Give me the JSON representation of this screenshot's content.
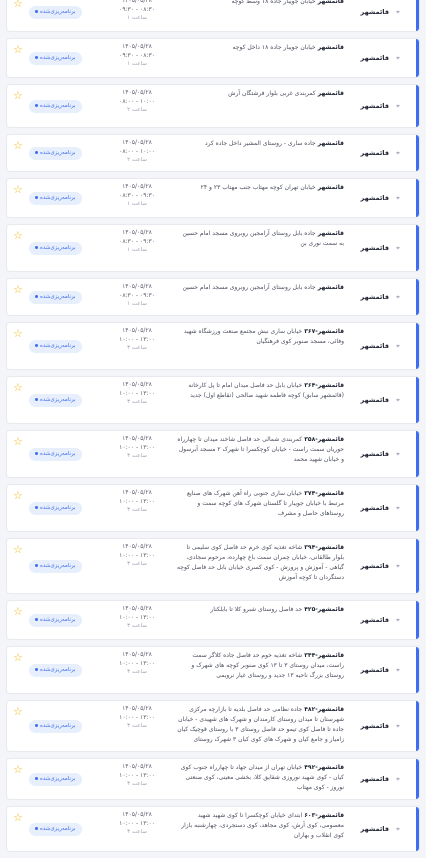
{
  "status_label": "برنامه‌ریزی‌شده",
  "colors": {
    "accent": "#3d6df2",
    "star": "#f2b70f",
    "badge_bg": "#e7eefc"
  },
  "icons": {
    "favorite": "star-icon",
    "location": "location-pin-icon"
  },
  "rows": [
    {
      "city": "قائمشهر",
      "desc": "خیابان جویبار جاده ۱۸ وسط کوچه",
      "date": "۱۴۰۵/۰۵/۲۸",
      "time": "۰۹:۳۰ - ۰۸:۳۰",
      "dur": "۱ ساعت"
    },
    {
      "city": "قائمشهر",
      "desc": "خیابان جویبار جاده ۱۸ داخل کوچه",
      "date": "۱۴۰۵/۰۵/۲۸",
      "time": "۰۹:۳۰ - ۰۸:۳۰",
      "dur": "۱ ساعت"
    },
    {
      "city": "قائمشهر",
      "desc": "کمربندی غربی بلوار فرشتگان آرش",
      "date": "۱۴۰۵/۰۵/۲۸",
      "time": "۰۸:۰۰ - ۱۰:۰۰",
      "dur": "۲ ساعت"
    },
    {
      "city": "قائمشهر",
      "desc": "جاده ساری - روستای المشیر داخل جاده کرد",
      "date": "۱۴۰۵/۰۵/۲۸",
      "time": "۰۸:۰۰ - ۱۰:۰۰",
      "dur": "۲ ساعت"
    },
    {
      "city": "قائمشهر",
      "desc": "خیابان تهران کوچه مهتاب جنب مهتاب ۲۳ و ۲۴",
      "date": "۱۴۰۵/۰۵/۲۸",
      "time": "۰۸:۳۰ - ۰۹:۳۰",
      "dur": "۱ ساعت"
    },
    {
      "city": "قائمشهر",
      "desc": "جاده بابل روستای آرامجین روبروی مسجد امام حسین به سمت نوری بن",
      "date": "۱۴۰۵/۰۵/۲۸",
      "time": "۰۸:۳۰ - ۰۹:۳۰",
      "dur": "۱ ساعت"
    },
    {
      "city": "قائمشهر",
      "desc": "جاده بابل روستای آرامجین روبروی مسجد امام حسین",
      "date": "۱۴۰۵/۰۵/۲۸",
      "time": "۰۸:۳۰ - ۰۹:۳۰",
      "dur": "۱ ساعت"
    },
    {
      "city": "قائمشهر",
      "prefix": "۳۶۷",
      "desc": "خیابان ساری نبش مجتمع صنعت ورزشگاه شهید وفائی، مسجد صنوبر کوی فرهنگیان",
      "date": "۱۴۰۵/۰۵/۲۸",
      "time": "۱۰:۰۰ - ۱۳:۰۰",
      "dur": "۳ ساعت"
    },
    {
      "city": "قائمشهر",
      "prefix": "۳۶۴",
      "desc": "خیابان بابل حد فاصل میدان امام تا پل کارخانه (قائمشهر سابق) کوچه فاطمه شهید صالحی (تقاطع اول) جدید",
      "date": "۱۴۰۵/۰۵/۲۸",
      "time": "۱۰:۰۰ - ۱۳:۰۰",
      "dur": "۳ ساعت"
    },
    {
      "city": "قائمشهر",
      "prefix": "۳۵۸",
      "desc": "کمربندی شمالی حد فاصل شاخند میدان تا چهارراه حوریان سمت راست - خیابان کوچکسرا تا شهرک ۲ مسجد آبرسول و خیابان شهید محمد",
      "date": "۱۴۰۵/۰۵/۲۸",
      "time": "۱۰:۰۰ - ۱۳:۰۰",
      "dur": "۳ ساعت"
    },
    {
      "city": "قائمشهر",
      "prefix": "۳۷۴",
      "desc": "خیابان ساری جنوبی راه آهن شهرک های صنایع مرتبط با خیابان جویبار تا گلستان شهرک های کوچه سمت و روستاهای حاصل و مشرف",
      "date": "۱۴۰۵/۰۵/۲۸",
      "time": "۱۰:۰۰ - ۱۳:۰۰",
      "dur": "۳ ساعت"
    },
    {
      "city": "قائمشهر",
      "prefix": "۳۹۴",
      "desc": "شاخه تغذیه کوی خرم حد فاصل کوی سلیمی تا بلوار طالقانی، خیابان چمران سمت باغ چهارده، مرحوم سجادی، گیاهی - آموزش و پرورش - کوی کسری خیابان بابل حد فاصل کوچه دستگردان تا کوچه آموزش",
      "date": "۱۴۰۵/۰۵/۲۸",
      "time": "۱۰:۰۰ - ۱۳:۰۰",
      "dur": "۳ ساعت"
    },
    {
      "city": "قائمشهر",
      "prefix": "۴۲۵",
      "desc": "حد فاصل روستای شبرو کلا تا بابلکنار",
      "date": "۱۴۰۵/۰۵/۲۸",
      "time": "۱۰:۰۰ - ۱۳:۰۰",
      "dur": "۳ ساعت"
    },
    {
      "city": "قائمشهر",
      "prefix": "۳۴۴",
      "desc": "شاخه تغذیه خوم حد فاصل جاده کلاگر سمت راست، میدان روستای ۳ تا ۱۳ کوی صنوبر کوچه های شهرک و روستای بزرگ ناحیه ۱۳ جدید و روستای غیار نرویمی",
      "date": "۱۴۰۵/۰۵/۲۸",
      "time": "۱۰:۰۰ - ۱۳:۰۰",
      "dur": "۳ ساعت"
    },
    {
      "city": "قائمشهر",
      "prefix": "۴۸۲",
      "desc": "جاده نظامی حد فاصل بلدیه تا بازارچه مرکزی شهرستان تا میدان روستای کارمندان و شهرک های شهیدی - خیابان جاده تا فاصل کوی تیمو حد فاصل روستای ۳ با روستای قوچیک کیان زامیار و جامع کیان و شهرک های کوی کیان ۳ شهرک روستای",
      "date": "۱۴۰۵/۰۵/۲۸",
      "time": "۱۰:۰۰ - ۱۳:۰۰",
      "dur": "۳ ساعت"
    },
    {
      "city": "قائمشهر",
      "prefix": "۴۹۲",
      "desc": "خیابان تهران از میدان جهاد تا چهارراه جنوب کوی کیان - کوی شهید نوروزی شقایق کلا، بخشی معینی، کوی صنعتی نوروز - کوی مهتاب",
      "date": "۱۴۰۵/۰۵/۲۸",
      "time": "۱۰:۰۰ - ۱۳:۰۰",
      "dur": "۳ ساعت"
    },
    {
      "city": "قائمشهر",
      "prefix": "۶۰۳",
      "desc": "ابتدای خیابان کوچکسرا تا کوی شهید شهید معصومی، کوی آرش، کوی مجاهد، کوی دستجردی، چهارشنبه بازار کوی انقلاب و بهاران",
      "date": "۱۴۰۵/۰۵/۲۸",
      "time": "۱۰:۰۰ - ۱۳:۰۰",
      "dur": "۳ ساعت"
    }
  ]
}
